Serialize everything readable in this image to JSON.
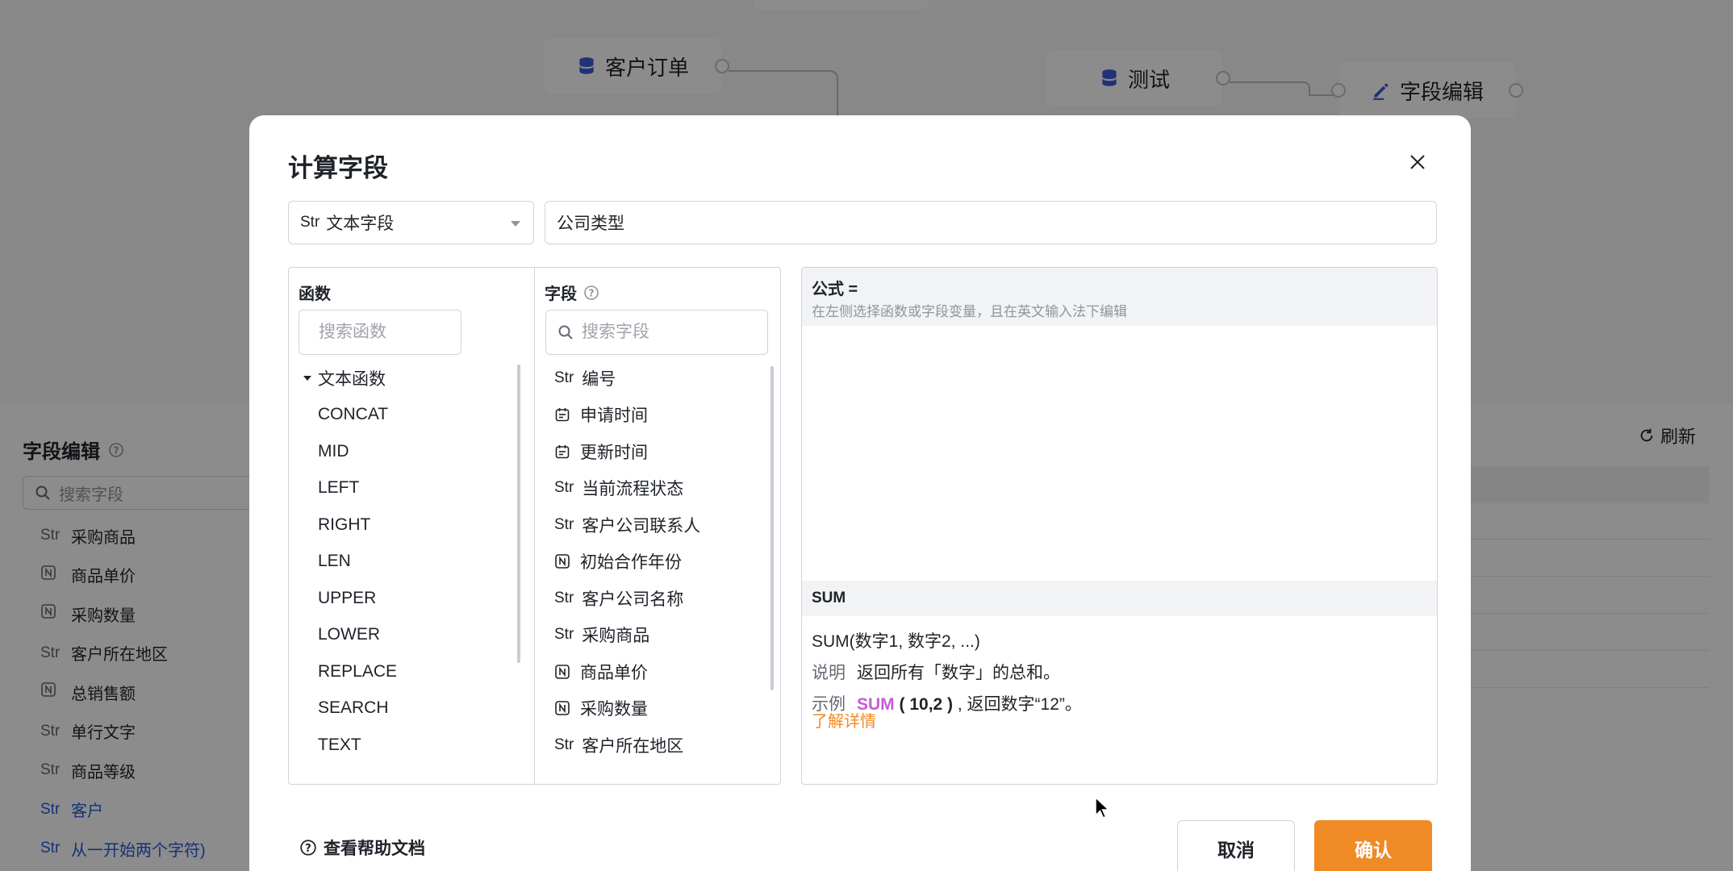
{
  "background": {
    "nodes": [
      {
        "label": "客户订单",
        "icon": "database-icon"
      },
      {
        "label": "测试",
        "icon": "database-icon"
      },
      {
        "label": "字段编辑",
        "icon": "edit-icon"
      }
    ],
    "panel_title": "字段编辑",
    "search_placeholder": "搜索字段",
    "refresh_label": "刷新",
    "fields": [
      {
        "type": "Str",
        "name": "采购商品"
      },
      {
        "type": "N",
        "name": "商品单价"
      },
      {
        "type": "N",
        "name": "采购数量"
      },
      {
        "type": "Str",
        "name": "客户所在地区"
      },
      {
        "type": "N",
        "name": "总销售额"
      },
      {
        "type": "Str",
        "name": "单行文字"
      },
      {
        "type": "Str",
        "name": "商品等级"
      },
      {
        "type": "Str",
        "name": "客户"
      },
      {
        "type": "Str",
        "name": "从一开始两个字符)"
      }
    ]
  },
  "modal": {
    "title": "计算字段",
    "field_type": {
      "prefix": "Str",
      "label": "文本字段"
    },
    "field_name_value": "公司类型",
    "functions": {
      "header": "函数",
      "search_placeholder": "搜索函数",
      "group": "文本函数",
      "items": [
        "CONCAT",
        "MID",
        "LEFT",
        "RIGHT",
        "LEN",
        "UPPER",
        "LOWER",
        "REPLACE",
        "SEARCH",
        "TEXT"
      ]
    },
    "fields": {
      "header": "字段",
      "search_placeholder": "搜索字段",
      "items": [
        {
          "type": "Str",
          "name": "编号"
        },
        {
          "type": "date",
          "name": "申请时间"
        },
        {
          "type": "date",
          "name": "更新时间"
        },
        {
          "type": "Str",
          "name": "当前流程状态"
        },
        {
          "type": "Str",
          "name": "客户公司联系人"
        },
        {
          "type": "N",
          "name": "初始合作年份"
        },
        {
          "type": "Str",
          "name": "客户公司名称"
        },
        {
          "type": "Str",
          "name": "采购商品"
        },
        {
          "type": "N",
          "name": "商品单价"
        },
        {
          "type": "N",
          "name": "采购数量"
        },
        {
          "type": "Str",
          "name": "客户所在地区"
        }
      ]
    },
    "formula": {
      "label": "公式 =",
      "hint": "在左侧选择函数或字段变量，且在英文输入法下编辑"
    },
    "doc": {
      "name": "SUM",
      "signature": "SUM(数字1, 数字2, ...)",
      "desc_label": "说明",
      "desc": "返回所有「数字」的总和。",
      "example_label": "示例",
      "example_fn": "SUM",
      "example_args": "( 10,2 )",
      "example_rest": ", 返回数字“12”。",
      "more_link": "了解详情"
    },
    "help_link": "查看帮助文档",
    "cancel_label": "取消",
    "confirm_label": "确认"
  },
  "colors": {
    "accent": "#f08a24",
    "function_highlight": "#c45bd6",
    "link_blue": "#245bdb"
  }
}
